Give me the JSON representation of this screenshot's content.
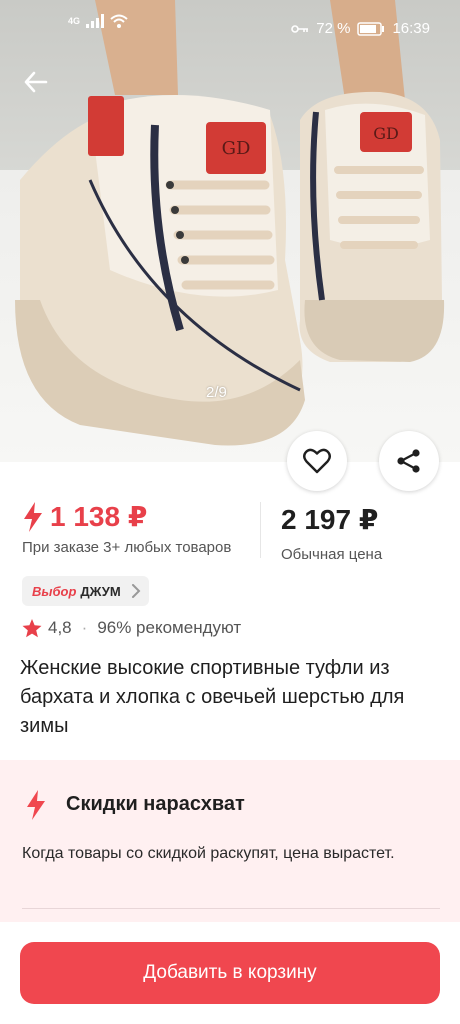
{
  "status_bar": {
    "network": "4G",
    "battery": "72 %",
    "time": "16:39"
  },
  "gallery": {
    "counter": "2/9"
  },
  "pricing": {
    "promo_price": "1 138 ₽",
    "promo_condition": "При заказе 3+ любых товаров",
    "regular_price": "2 197 ₽",
    "regular_label": "Обычная цена"
  },
  "badge": {
    "prefix": "Выбор",
    "name": "ДЖУМ"
  },
  "rating": {
    "score": "4,8",
    "separator": "·",
    "recommend": "96% рекомендуют"
  },
  "product": {
    "title": "Женские высокие спортивные туфли из бархата и хлопка с овечьей шерстью для зимы"
  },
  "flash_sale": {
    "title": "Скидки нарасхват",
    "description": "Когда товары со скидкой раскупят, цена вырастет."
  },
  "actions": {
    "add_to_cart": "Добавить в корзину"
  },
  "icons": {
    "back": "arrow-left-icon",
    "favorite": "heart-icon",
    "share": "share-icon",
    "lightning": "lightning-icon",
    "star": "star-icon",
    "chevron": "chevron-right-icon"
  },
  "colors": {
    "accent": "#f0474f",
    "promo_price": "#e8404a",
    "flash_bg": "#fff0f1"
  }
}
